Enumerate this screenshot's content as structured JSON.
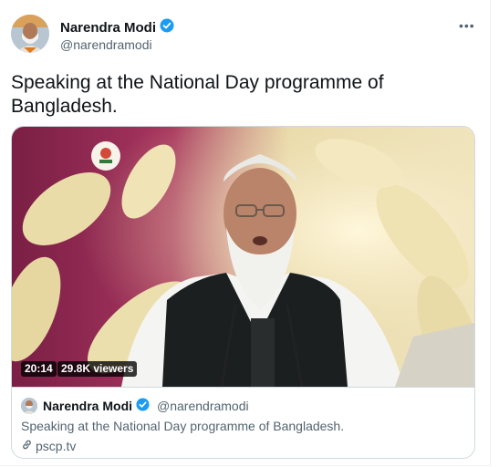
{
  "author": {
    "name": "Narendra Modi",
    "handle": "@narendramodi",
    "verified_icon": "verified-badge-icon"
  },
  "menu_icon": "more-options-icon",
  "more_glyph": "•••",
  "tweet": {
    "text": "Speaking at the National Day programme of Bangladesh."
  },
  "video": {
    "duration": "20:14",
    "viewers": "29.8K viewers"
  },
  "card": {
    "name": "Narendra Modi",
    "handle": "@narendramodi",
    "description": "Speaking at the National Day programme of Bangladesh.",
    "link": "pscp.tv",
    "link_icon": "link-icon"
  },
  "colors": {
    "verified": "#1d9bf0",
    "secondary_text": "#536471",
    "border": "#cfd9de"
  }
}
